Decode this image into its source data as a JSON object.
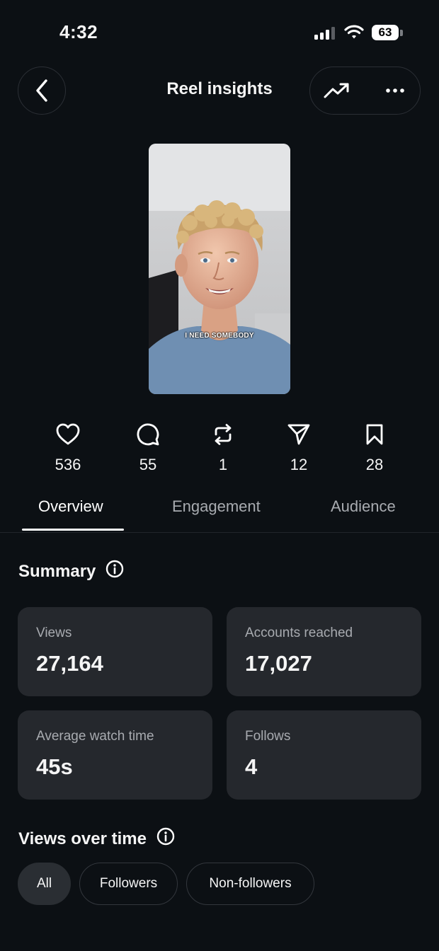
{
  "status_bar": {
    "time": "4:32",
    "battery": "63"
  },
  "header": {
    "title": "Reel insights"
  },
  "reel": {
    "caption": "I NEED SOMEBODY"
  },
  "stats": [
    {
      "icon": "heart-icon",
      "value": "536"
    },
    {
      "icon": "comment-icon",
      "value": "55"
    },
    {
      "icon": "repost-icon",
      "value": "1"
    },
    {
      "icon": "share-icon",
      "value": "12"
    },
    {
      "icon": "bookmark-icon",
      "value": "28"
    }
  ],
  "tabs": [
    {
      "label": "Overview",
      "active": true
    },
    {
      "label": "Engagement",
      "active": false
    },
    {
      "label": "Audience",
      "active": false
    }
  ],
  "summary": {
    "title": "Summary",
    "cards": [
      {
        "label": "Views",
        "value": "27,164"
      },
      {
        "label": "Accounts reached",
        "value": "17,027"
      },
      {
        "label": "Average watch time",
        "value": "45s"
      },
      {
        "label": "Follows",
        "value": "4"
      }
    ]
  },
  "views_over_time": {
    "title": "Views over time",
    "filters": [
      {
        "label": "All",
        "selected": true
      },
      {
        "label": "Followers",
        "selected": false
      },
      {
        "label": "Non-followers",
        "selected": false
      }
    ]
  },
  "colors": {
    "background": "#0c1014",
    "card": "#25282d",
    "muted_text": "#a8abb0"
  }
}
